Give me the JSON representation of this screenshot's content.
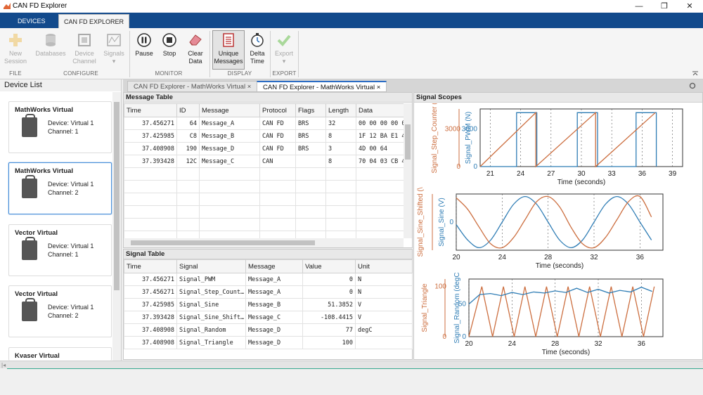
{
  "window": {
    "title": "CAN FD Explorer",
    "minimize_icon": "—",
    "restore_icon": "❐",
    "close_icon": "✕"
  },
  "tabs": [
    {
      "label": "DEVICES"
    },
    {
      "label": "CAN FD EXPLORER"
    }
  ],
  "ribbon": {
    "buttons": [
      {
        "line1": "New",
        "line2": "Session"
      },
      {
        "line1": "Databases",
        "line2": ""
      },
      {
        "line1": "Device",
        "line2": "Channel"
      },
      {
        "line1": "Signals",
        "line2": "▾"
      },
      {
        "line1": "Pause",
        "line2": ""
      },
      {
        "line1": "Stop",
        "line2": ""
      },
      {
        "line1": "Clear",
        "line2": "Data"
      },
      {
        "line1": "Unique",
        "line2": "Messages"
      },
      {
        "line1": "Delta",
        "line2": "Time"
      },
      {
        "line1": "Export",
        "line2": "▾"
      }
    ],
    "groups": [
      "FILE",
      "CONFIGURE",
      "MONITOR",
      "DISPLAY",
      "EXPORT"
    ]
  },
  "device_list": {
    "title": "Device List",
    "devices": [
      {
        "name": "MathWorks Virtual",
        "device": "Device: Virtual 1",
        "channel": "Channel: 1"
      },
      {
        "name": "MathWorks Virtual",
        "device": "Device: Virtual 1",
        "channel": "Channel: 2"
      },
      {
        "name": "Vector Virtual",
        "device": "Device: Virtual 1",
        "channel": "Channel: 1"
      },
      {
        "name": "Vector Virtual",
        "device": "Device: Virtual 1",
        "channel": "Channel: 2"
      },
      {
        "name": "Kvaser Virtual",
        "device": "",
        "channel": ""
      }
    ]
  },
  "doc_tabs": [
    {
      "label": "CAN FD Explorer - MathWorks Virtual"
    },
    {
      "label": "CAN FD Explorer - MathWorks Virtual"
    }
  ],
  "message_table": {
    "title": "Message Table",
    "columns": [
      "Time",
      "ID",
      "Message",
      "Protocol",
      "Flags",
      "Length",
      "Data"
    ],
    "rows": [
      [
        "37.456271",
        "64",
        "Message_A",
        "CAN FD",
        "BRS",
        "32",
        "00 00 00 00 0"
      ],
      [
        "37.425985",
        "C8",
        "Message_B",
        "CAN FD",
        "BRS",
        "8",
        "1F 12 BA E1 4"
      ],
      [
        "37.408908",
        "190",
        "Message_D",
        "CAN FD",
        "BRS",
        "3",
        "4D 00 64"
      ],
      [
        "37.393428",
        "12C",
        "Message_C",
        "CAN",
        "",
        "8",
        "70 04 03 CB 4"
      ]
    ]
  },
  "signal_table": {
    "title": "Signal Table",
    "columns": [
      "Time",
      "Signal",
      "Message",
      "Value",
      "Unit"
    ],
    "rows": [
      [
        "37.456271",
        "Signal_PWM",
        "Message_A",
        "0",
        "N"
      ],
      [
        "37.456271",
        "Signal_Step_Count…",
        "Message_A",
        "0",
        "N"
      ],
      [
        "37.425985",
        "Signal_Sine",
        "Message_B",
        "51.3852",
        "V"
      ],
      [
        "37.393428",
        "Signal_Sine_Shift…",
        "Message_C",
        "-108.4415",
        "V"
      ],
      [
        "37.408908",
        "Signal_Random",
        "Message_D",
        "77",
        "degC"
      ],
      [
        "37.408908",
        "Signal_Triangle",
        "Message_D",
        "100",
        ""
      ]
    ]
  },
  "signal_scopes": {
    "title": "Signal Scopes"
  },
  "chart_data": [
    {
      "type": "line",
      "xlabel": "Time (seconds)",
      "xlim": [
        20,
        40
      ],
      "x_ticks": [
        "21",
        "24",
        "27",
        "30",
        "33",
        "36",
        "39"
      ],
      "y_left_label": "Signal_Step_Counter (",
      "y_left_ticks": [
        "0",
        "3000"
      ],
      "y_right_label": "Signal_PWM (N)",
      "y_right_ticks": [
        "0",
        "3000"
      ],
      "series": [
        {
          "name": "Signal_PWM",
          "color": "#2f7db5",
          "x": [
            20,
            23.6,
            23.6,
            25.6,
            25.6,
            29.6,
            29.6,
            31.6,
            31.6,
            35.4,
            35.4,
            37.4,
            37.4
          ],
          "y": [
            0,
            0,
            4300,
            4300,
            0,
            0,
            4300,
            4300,
            0,
            0,
            4300,
            4300,
            0
          ]
        },
        {
          "name": "Signal_Step_Counter",
          "color": "#cc6e3f",
          "x": [
            20,
            25.5,
            25.5,
            31.4,
            31.4,
            37.3
          ],
          "y": [
            0,
            4300,
            0,
            4300,
            0,
            4300
          ]
        }
      ]
    },
    {
      "type": "line",
      "xlabel": "Time (seconds)",
      "xlim": [
        20,
        38
      ],
      "x_ticks": [
        "20",
        "24",
        "28",
        "32",
        "36"
      ],
      "y_left_label": "Signal_Sine_Shifted (\\",
      "y_left_ticks": [],
      "y_right_label": "Signal_Sine (V)",
      "y_right_ticks": [
        "0"
      ],
      "series": [
        {
          "name": "Signal_Sine",
          "color": "#2f7db5",
          "x": [
            20,
            21,
            22,
            23,
            24,
            25,
            26,
            27,
            28,
            29,
            30,
            31,
            32,
            33,
            34,
            35,
            36,
            37
          ],
          "y": [
            -0.1,
            -0.7,
            -1,
            -0.7,
            0,
            0.7,
            1,
            0.7,
            0,
            -0.7,
            -1,
            -0.7,
            0,
            0.7,
            1,
            0.7,
            0,
            -0.7
          ]
        },
        {
          "name": "Signal_Sine_Shifted",
          "color": "#cc6e3f",
          "x": [
            20,
            21,
            22,
            23,
            24,
            25,
            26,
            27,
            28,
            29,
            30,
            31,
            32,
            33,
            34,
            35,
            36,
            37
          ],
          "y": [
            0.95,
            0.5,
            -0.2,
            -0.85,
            -1,
            -0.6,
            0.1,
            0.8,
            1,
            0.6,
            -0.2,
            -0.85,
            -1,
            -0.6,
            0.1,
            0.8,
            1,
            0.2
          ]
        }
      ]
    },
    {
      "type": "line",
      "xlabel": "Time (seconds)",
      "xlim": [
        20,
        38
      ],
      "x_ticks": [
        "20",
        "24",
        "28",
        "32",
        "36"
      ],
      "y_left_label": "Signal_Triangle",
      "y_left_ticks": [
        "0",
        "100"
      ],
      "y_right_label": "Signal_Random (degC",
      "y_right_ticks": [
        "0",
        "50"
      ],
      "series": [
        {
          "name": "Signal_Triangle",
          "color": "#cc6e3f",
          "x": [
            20,
            21.2,
            22.2,
            23.2,
            24.2,
            25.2,
            26.2,
            27.2,
            28.2,
            29.2,
            30.2,
            31.2,
            32.2,
            33.2,
            34.2,
            35.2,
            36.2,
            37.2
          ],
          "y": [
            0,
            100,
            0,
            100,
            0,
            100,
            0,
            100,
            0,
            100,
            0,
            100,
            0,
            100,
            0,
            100,
            0,
            100
          ]
        },
        {
          "name": "Signal_Random",
          "color": "#2f7db5",
          "x": [
            20,
            21,
            22,
            23,
            24,
            25,
            26,
            27,
            28,
            29,
            30,
            31,
            32,
            33,
            34,
            35,
            36,
            37
          ],
          "y": [
            62,
            80,
            82,
            78,
            84,
            80,
            85,
            83,
            87,
            84,
            92,
            84,
            90,
            83,
            88,
            85,
            94,
            86
          ]
        }
      ]
    }
  ]
}
